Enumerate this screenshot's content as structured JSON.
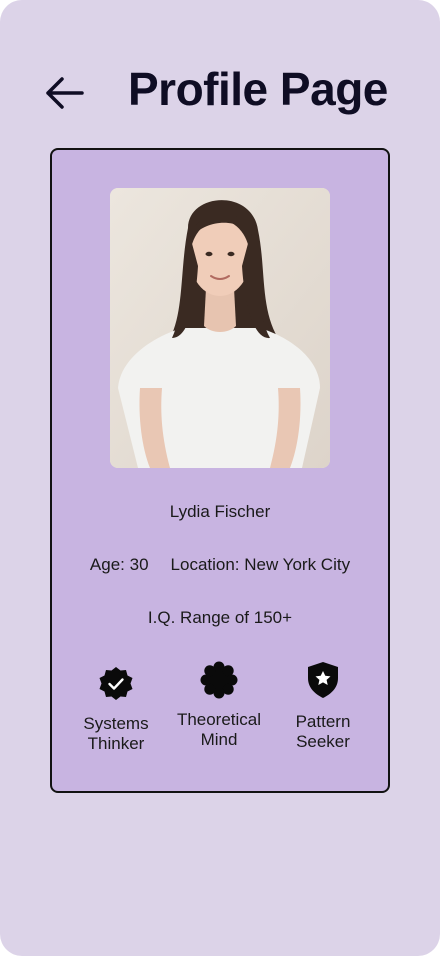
{
  "header": {
    "back_icon": "arrow-left-icon",
    "title": "Profile Page"
  },
  "profile": {
    "photo_alt": "Lydia Fischer",
    "name": "Lydia Fischer",
    "age": "Age: 30",
    "location": "Location: New York City",
    "iq": "I.Q. Range of 150+"
  },
  "badges": [
    {
      "icon": "verified-check-badge-icon",
      "label": "Systems\nThinker"
    },
    {
      "icon": "scalloped-badge-icon",
      "label": "Theoretical\nMind"
    },
    {
      "icon": "shield-star-icon",
      "label": "Pattern\nSeeker"
    }
  ],
  "colors": {
    "background": "#dcd3e8",
    "card": "#c8b4e1",
    "text": "#1a1a1a",
    "title": "#0f0d24"
  }
}
